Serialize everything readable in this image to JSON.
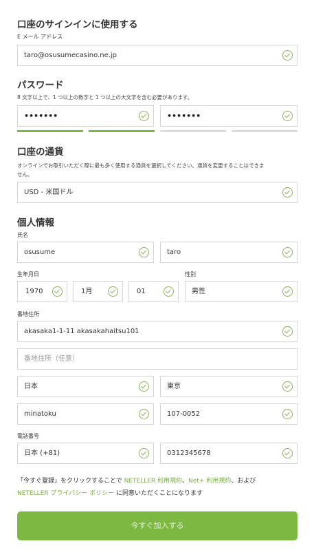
{
  "login": {
    "heading": "口座のサインインに使用する",
    "email_label": "E メール アドレス",
    "email_value": "taro@osusumecasino.ne.jp"
  },
  "password": {
    "heading": "パスワード",
    "hint": "8 文字以上で、1 つ以上の数字と 1 つ以上の大文字を含む必要があります。",
    "value": "•••••••",
    "confirm_value": "•••••••"
  },
  "currency": {
    "heading": "口座の通貨",
    "hint": "オンラインでお取引いただく際に最も多く使用する通貨を選択してください。通貨を変更することはできません。",
    "hint_line1": "オンラインでお取引いただく際に最も多く使用する通貨を選択してください。通貨を変更することはできま",
    "hint_line2": "せん。",
    "value": "USD - 米国ドル"
  },
  "personal": {
    "heading": "個人情報",
    "name_label": "氏名",
    "last_name": "osusume",
    "first_name": "taro",
    "dob_label": "生年月日",
    "dob_year": "1970",
    "dob_month": "1月",
    "dob_day": "01",
    "gender_label": "性別",
    "gender": "男性",
    "address_label": "番地住所",
    "address1": "akasaka1-1-11 akasakahaitsu101",
    "address2_placeholder": "番地住所（任意）",
    "country": "日本",
    "region": "東京",
    "city": "minatoku",
    "postal": "107-0052",
    "phone_label": "電話番号",
    "phone_code": "日本 (+81)",
    "phone": "0312345678"
  },
  "terms": {
    "t1": "「今すぐ登録」をクリックすることで ",
    "link1": "NETELLER 利用規約",
    "t2": "、",
    "link2": "Net+ 利用規約",
    "t3": "、および",
    "link3": "NETELLER プライバシー ポリシー",
    "t4": " に同意いただくことになります"
  },
  "submit_label": "今すぐ加入する",
  "colors": {
    "accent": "#7db843",
    "check": "#8bb35a",
    "border": "#d4d4d4"
  }
}
